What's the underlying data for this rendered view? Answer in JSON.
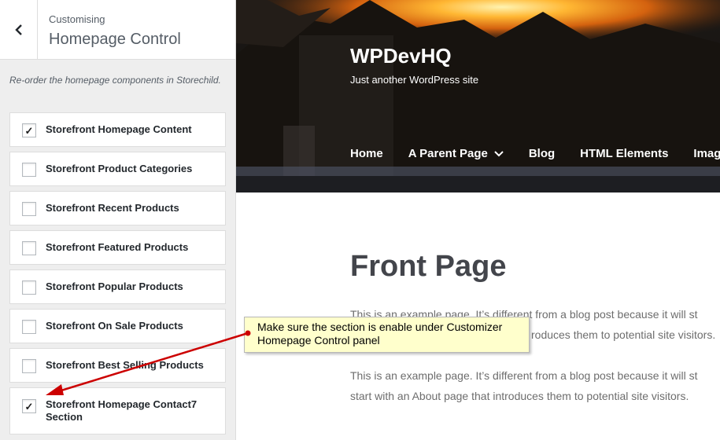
{
  "customizer": {
    "breadcrumb": "Customising",
    "title": "Homepage Control",
    "description": "Re-order the homepage components in Storechild.",
    "items": [
      {
        "label": "Storefront Homepage Content",
        "checked": true
      },
      {
        "label": "Storefront Product Categories",
        "checked": false
      },
      {
        "label": "Storefront Recent Products",
        "checked": false
      },
      {
        "label": "Storefront Featured Products",
        "checked": false
      },
      {
        "label": "Storefront Popular Products",
        "checked": false
      },
      {
        "label": "Storefront On Sale Products",
        "checked": false
      },
      {
        "label": "Storefront Best Selling Products",
        "checked": false
      },
      {
        "label": "Storefront Homepage Contact7 Section",
        "checked": true
      }
    ]
  },
  "site": {
    "title": "WPDevHQ",
    "tagline": "Just another WordPress site",
    "nav": [
      "Home",
      "A Parent Page",
      "Blog",
      "HTML Elements",
      "Imag"
    ]
  },
  "page": {
    "title": "Front Page",
    "p1_line1": "This is an example page. It’s different from a blog post because it will st",
    "p1_line2": "roduces them to potential site visitors.",
    "p2_line1": "This is an example page. It’s different from a blog post because it will st",
    "p2_line2": "start with an About page that introduces them to potential site visitors."
  },
  "callout": {
    "line1": "Make sure the section is enable under Customizer",
    "line2": "Homepage Control panel"
  },
  "colors": {
    "panel_bg": "#eeeeee",
    "callout_bg": "#ffffcc",
    "arrow": "#cc0000"
  }
}
